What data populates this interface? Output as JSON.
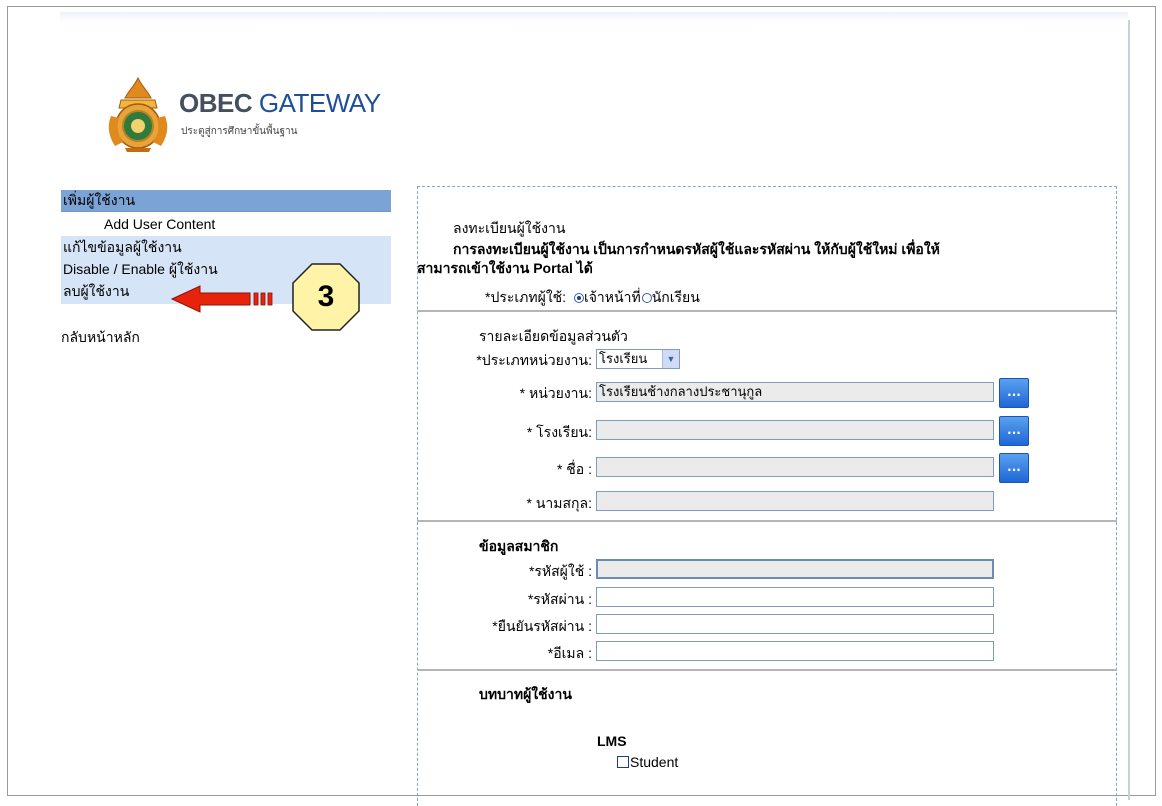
{
  "logo": {
    "title_part1": "OBEC",
    "title_part2": "GATEWAY",
    "subtitle": "ประตูสู่การศึกษาขั้นพื้นฐาน"
  },
  "menu": {
    "header": "เพิ่มผู้ใช้งาน",
    "sub_item": "Add User Content",
    "items": [
      "แก้ไขข้อมูลผู้ใช้งาน",
      "Disable / Enable ผู้ใช้งาน",
      "ลบผู้ใช้งาน"
    ],
    "back": "กลับหน้าหลัก"
  },
  "annotation": {
    "step_number": "3"
  },
  "form": {
    "title": "ลงทะเบียนผู้ใช้งาน",
    "description_line1": "การลงทะเบียนผู้ใช้งาน เป็นการกำหนดรหัสผู้ใช้และรหัสผ่าน ให้กับผู้ใช้ใหม่ เพื่อให้",
    "description_line2": "สามารถเข้าใช้งาน Portal ได้",
    "user_type": {
      "label": "*ประเภทผู้ใช้:",
      "options": [
        "เจ้าหน้าที่",
        "นักเรียน"
      ],
      "selected": "เจ้าหน้าที่"
    },
    "personal": {
      "heading": "รายละเอียดข้อมูลส่วนตัว",
      "unit_type_label": "*ประเภทหน่วยงาน:",
      "unit_type_value": "โรงเรียน",
      "unit_label": "* หน่วยงาน:",
      "unit_value": "โรงเรียนช้างกลางประชานุกูล",
      "school_label": "* โรงเรียน:",
      "school_value": "",
      "firstname_label": "* ชื่อ :",
      "firstname_value": "",
      "lastname_label": "* นามสกุล:",
      "lastname_value": "",
      "browse_label": "..."
    },
    "member": {
      "heading": "ข้อมูลสมาชิก",
      "username_label": "*รหัสผู้ใช้ :",
      "username_value": "",
      "password_label": "*รหัสผ่าน :",
      "password_value": "",
      "confirm_label": "*ยืนยันรหัสผ่าน :",
      "confirm_value": "",
      "email_label": "*อีเมล :",
      "email_value": ""
    },
    "roles": {
      "heading": "บทบาทผู้ใช้งาน",
      "group": "LMS",
      "options": [
        "Student"
      ]
    }
  },
  "colors": {
    "menu_header": "#7ba3d6",
    "menu_item_bg": "#d5e4f6",
    "arrow": "#e8230c",
    "badge": "#fff3a8",
    "button": "#1f67d6"
  }
}
